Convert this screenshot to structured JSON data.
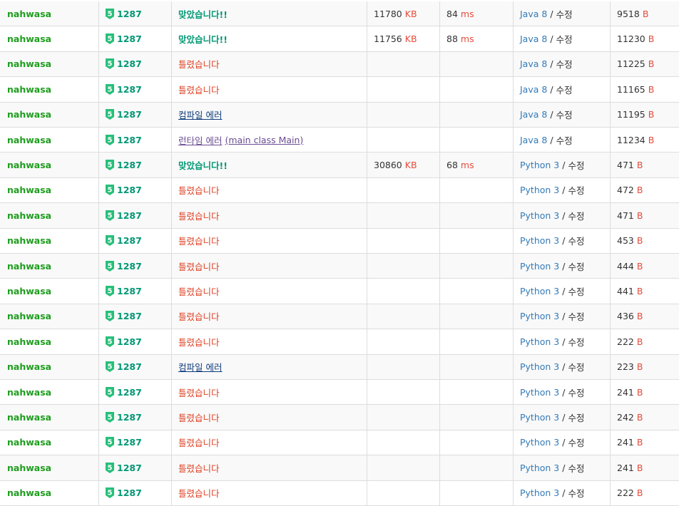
{
  "units": {
    "memory": "KB",
    "time": "ms",
    "length": "B"
  },
  "edit_label": "수정",
  "tier_label": "5",
  "tier_color": "#27bf7a",
  "rows": [
    {
      "user": "nahwasa",
      "problem": "1287",
      "result": "맞았습니다!!",
      "status": "ac",
      "memory": "11780",
      "time": "84",
      "language": "Java 8",
      "length": "9518"
    },
    {
      "user": "nahwasa",
      "problem": "1287",
      "result": "맞았습니다!!",
      "status": "ac",
      "memory": "11756",
      "time": "88",
      "language": "Java 8",
      "length": "11230"
    },
    {
      "user": "nahwasa",
      "problem": "1287",
      "result": "틀렸습니다",
      "status": "wa",
      "memory": "",
      "time": "",
      "language": "Java 8",
      "length": "11225"
    },
    {
      "user": "nahwasa",
      "problem": "1287",
      "result": "틀렸습니다",
      "status": "wa",
      "memory": "",
      "time": "",
      "language": "Java 8",
      "length": "11165"
    },
    {
      "user": "nahwasa",
      "problem": "1287",
      "result": "컴파일 에러",
      "status": "ce",
      "memory": "",
      "time": "",
      "language": "Java 8",
      "length": "11195"
    },
    {
      "user": "nahwasa",
      "problem": "1287",
      "result": "런타임 에러",
      "detail": "(main class Main)",
      "status": "re",
      "memory": "",
      "time": "",
      "language": "Java 8",
      "length": "11234"
    },
    {
      "user": "nahwasa",
      "problem": "1287",
      "result": "맞았습니다!!",
      "status": "ac",
      "memory": "30860",
      "time": "68",
      "language": "Python 3",
      "length": "471"
    },
    {
      "user": "nahwasa",
      "problem": "1287",
      "result": "틀렸습니다",
      "status": "wa",
      "memory": "",
      "time": "",
      "language": "Python 3",
      "length": "472"
    },
    {
      "user": "nahwasa",
      "problem": "1287",
      "result": "틀렸습니다",
      "status": "wa",
      "memory": "",
      "time": "",
      "language": "Python 3",
      "length": "471"
    },
    {
      "user": "nahwasa",
      "problem": "1287",
      "result": "틀렸습니다",
      "status": "wa",
      "memory": "",
      "time": "",
      "language": "Python 3",
      "length": "453"
    },
    {
      "user": "nahwasa",
      "problem": "1287",
      "result": "틀렸습니다",
      "status": "wa",
      "memory": "",
      "time": "",
      "language": "Python 3",
      "length": "444"
    },
    {
      "user": "nahwasa",
      "problem": "1287",
      "result": "틀렸습니다",
      "status": "wa",
      "memory": "",
      "time": "",
      "language": "Python 3",
      "length": "441"
    },
    {
      "user": "nahwasa",
      "problem": "1287",
      "result": "틀렸습니다",
      "status": "wa",
      "memory": "",
      "time": "",
      "language": "Python 3",
      "length": "436"
    },
    {
      "user": "nahwasa",
      "problem": "1287",
      "result": "틀렸습니다",
      "status": "wa",
      "memory": "",
      "time": "",
      "language": "Python 3",
      "length": "222"
    },
    {
      "user": "nahwasa",
      "problem": "1287",
      "result": "컴파일 에러",
      "status": "ce",
      "memory": "",
      "time": "",
      "language": "Python 3",
      "length": "223"
    },
    {
      "user": "nahwasa",
      "problem": "1287",
      "result": "틀렸습니다",
      "status": "wa",
      "memory": "",
      "time": "",
      "language": "Python 3",
      "length": "241"
    },
    {
      "user": "nahwasa",
      "problem": "1287",
      "result": "틀렸습니다",
      "status": "wa",
      "memory": "",
      "time": "",
      "language": "Python 3",
      "length": "242"
    },
    {
      "user": "nahwasa",
      "problem": "1287",
      "result": "틀렸습니다",
      "status": "wa",
      "memory": "",
      "time": "",
      "language": "Python 3",
      "length": "241"
    },
    {
      "user": "nahwasa",
      "problem": "1287",
      "result": "틀렸습니다",
      "status": "wa",
      "memory": "",
      "time": "",
      "language": "Python 3",
      "length": "241"
    },
    {
      "user": "nahwasa",
      "problem": "1287",
      "result": "틀렸습니다",
      "status": "wa",
      "memory": "",
      "time": "",
      "language": "Python 3",
      "length": "222"
    }
  ]
}
